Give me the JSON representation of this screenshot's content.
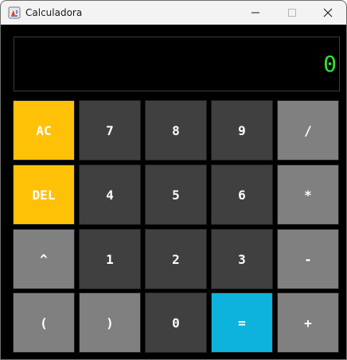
{
  "window": {
    "title": "Calculadora"
  },
  "display": {
    "value": "0",
    "value_color": "#2ee62e"
  },
  "colors": {
    "function": "#ffc107",
    "digit": "#404040",
    "operator": "#808080",
    "equals": "#0eb3dd"
  },
  "keys": {
    "ac": "AC",
    "seven": "7",
    "eight": "8",
    "nine": "9",
    "divide": "/",
    "del": "DEL",
    "four": "4",
    "five": "5",
    "six": "6",
    "multiply": "*",
    "power": "^",
    "one": "1",
    "two": "2",
    "three": "3",
    "minus": "-",
    "lparen": "(",
    "rparen": ")",
    "zero": "0",
    "equals": "=",
    "plus": "+"
  }
}
